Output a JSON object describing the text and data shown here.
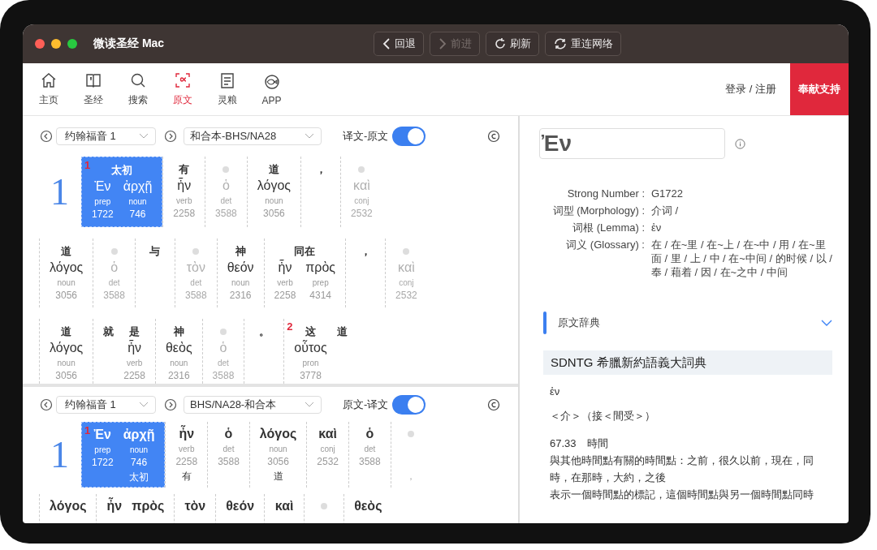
{
  "window": {
    "title": "微读圣经 Mac"
  },
  "toolbar": [
    {
      "kind": "back",
      "label": "回退",
      "disabled": false
    },
    {
      "kind": "forward",
      "label": "前进",
      "disabled": true
    },
    {
      "kind": "refresh",
      "label": "刷新",
      "disabled": false
    },
    {
      "kind": "sync",
      "label": "重连网络",
      "disabled": false
    }
  ],
  "nav": {
    "items": [
      {
        "kind": "home",
        "label": "主页",
        "selected": false
      },
      {
        "kind": "bible",
        "label": "圣经",
        "selected": false
      },
      {
        "kind": "search",
        "label": "搜索",
        "selected": false
      },
      {
        "kind": "original",
        "label": "原文",
        "selected": true
      },
      {
        "kind": "notes",
        "label": "灵粮",
        "selected": false
      },
      {
        "kind": "app",
        "label": "APP",
        "selected": false
      }
    ],
    "login": "登录 / 注册",
    "donate": "奉献支持"
  },
  "panes": [
    {
      "kind": "zh-first",
      "book": "约翰福音 1",
      "version": "和合本-BHS/NA28",
      "toggle": {
        "label": "译文-原文",
        "on": true
      },
      "lines": [
        {
          "verse": "1",
          "words": [
            {
              "selected": true,
              "faded": false,
              "mark": "1",
              "zh": "太初",
              "cols": [
                {
                  "greek": "Ἐν",
                  "pos": "prep",
                  "num": "1722"
                },
                {
                  "greek": "ἀρχῇ",
                  "pos": "noun",
                  "num": "746"
                }
              ]
            },
            {
              "selected": false,
              "faded": false,
              "cols": [
                {
                  "zh": "有",
                  "greek": "ἦν",
                  "pos": "verb",
                  "num": "2258"
                }
              ]
            },
            {
              "selected": false,
              "faded": true,
              "cols": [
                {
                  "greek": "ὁ",
                  "pos": "det",
                  "num": "3588"
                }
              ]
            },
            {
              "selected": false,
              "faded": false,
              "cols": [
                {
                  "zh": "道",
                  "greek": "λόγος",
                  "pos": "noun",
                  "num": "3056"
                }
              ]
            },
            {
              "selected": false,
              "faded": false,
              "cols": [
                {
                  "zh": "，"
                }
              ]
            },
            {
              "selected": false,
              "faded": true,
              "cols": [
                {
                  "greek": "καὶ",
                  "pos": "conj",
                  "num": "2532"
                }
              ]
            }
          ]
        },
        {
          "words": [
            {
              "selected": false,
              "faded": false,
              "cols": [
                {
                  "zh": "道",
                  "greek": "λόγος",
                  "pos": "noun",
                  "num": "3056"
                }
              ]
            },
            {
              "selected": false,
              "faded": true,
              "cols": [
                {
                  "greek": "ὁ",
                  "pos": "det",
                  "num": "3588"
                }
              ]
            },
            {
              "selected": false,
              "faded": false,
              "cols": [
                {
                  "zh": "与"
                }
              ]
            },
            {
              "selected": false,
              "faded": true,
              "cols": [
                {
                  "greek": "τὸν",
                  "pos": "det",
                  "num": "3588"
                }
              ]
            },
            {
              "selected": false,
              "faded": false,
              "cols": [
                {
                  "zh": "神",
                  "greek": "θεόν",
                  "pos": "noun",
                  "num": "2316"
                }
              ]
            },
            {
              "selected": false,
              "faded": false,
              "zh": "同在",
              "cols": [
                {
                  "greek": "ἦν",
                  "pos": "verb",
                  "num": "2258"
                },
                {
                  "greek": "πρὸς",
                  "pos": "prep",
                  "num": "4314"
                }
              ]
            },
            {
              "selected": false,
              "faded": false,
              "cols": [
                {
                  "zh": "，"
                }
              ]
            },
            {
              "selected": false,
              "faded": true,
              "cols": [
                {
                  "greek": "καὶ",
                  "pos": "conj",
                  "num": "2532"
                }
              ]
            }
          ]
        },
        {
          "words": [
            {
              "selected": false,
              "faded": false,
              "cols": [
                {
                  "zh": "道",
                  "greek": "λόγος",
                  "pos": "noun",
                  "num": "3056"
                }
              ]
            },
            {
              "selected": false,
              "faded": false,
              "cols": [
                {
                  "zh": "就"
                },
                {
                  "zh": "是",
                  "greek": "ἦν",
                  "pos": "verb",
                  "num": "2258"
                }
              ]
            },
            {
              "selected": false,
              "faded": false,
              "cols": [
                {
                  "zh": "神",
                  "greek": "θεὸς",
                  "pos": "noun",
                  "num": "2316"
                }
              ]
            },
            {
              "selected": false,
              "faded": true,
              "cols": [
                {
                  "greek": "ὁ",
                  "pos": "det",
                  "num": "3588"
                }
              ]
            },
            {
              "selected": false,
              "faded": false,
              "cols": [
                {
                  "zh": "。"
                }
              ]
            },
            {
              "selected": false,
              "faded": false,
              "mark": "2",
              "cols": [
                {
                  "zh": "这",
                  "greek": "οὗτος",
                  "pos": "pron",
                  "num": "3778"
                },
                {
                  "zh": "道"
                }
              ]
            }
          ]
        }
      ]
    },
    {
      "kind": "greek-first",
      "book": "约翰福音 1",
      "version": "BHS/NA28-和合本",
      "toggle": {
        "label": "原文-译文",
        "on": true
      },
      "lines": [
        {
          "verse": "1",
          "words": [
            {
              "selected": true,
              "faded": false,
              "mark": "1",
              "cols": [
                {
                  "greek": "Ἐν",
                  "pos": "prep",
                  "num": "1722"
                },
                {
                  "greek": "ἀρχῇ",
                  "pos": "noun",
                  "num": "746",
                  "zh": "太初"
                }
              ]
            },
            {
              "selected": false,
              "faded": false,
              "cols": [
                {
                  "greek": "ἦν",
                  "pos": "verb",
                  "num": "2258",
                  "zh": "有"
                }
              ]
            },
            {
              "selected": false,
              "faded": false,
              "cols": [
                {
                  "greek": "ὁ",
                  "pos": "det",
                  "num": "3588"
                }
              ]
            },
            {
              "selected": false,
              "faded": false,
              "cols": [
                {
                  "greek": "λόγος",
                  "pos": "noun",
                  "num": "3056",
                  "zh": "道"
                }
              ]
            },
            {
              "selected": false,
              "faded": false,
              "cols": [
                {
                  "greek": "καὶ",
                  "pos": "conj",
                  "num": "2532"
                }
              ]
            },
            {
              "selected": false,
              "faded": false,
              "cols": [
                {
                  "greek": "ὁ",
                  "pos": "det",
                  "num": "3588"
                }
              ]
            },
            {
              "selected": false,
              "faded": true,
              "cols": [
                {
                  "zh": "，"
                }
              ]
            }
          ]
        },
        {
          "words": [
            {
              "selected": false,
              "faded": false,
              "cols": [
                {
                  "greek": "λόγος"
                }
              ]
            },
            {
              "selected": false,
              "faded": false,
              "cols": [
                {
                  "greek": "ἦν"
                },
                {
                  "greek": "πρὸς"
                }
              ]
            },
            {
              "selected": false,
              "faded": false,
              "cols": [
                {
                  "greek": "τὸν"
                }
              ]
            },
            {
              "selected": false,
              "faded": false,
              "cols": [
                {
                  "greek": "θεόν"
                }
              ]
            },
            {
              "selected": false,
              "faded": false,
              "cols": [
                {
                  "greek": "καὶ"
                }
              ]
            },
            {
              "selected": false,
              "faded": true
            },
            {
              "selected": false,
              "faded": false,
              "cols": [
                {
                  "greek": "θεὸς"
                }
              ]
            }
          ]
        }
      ]
    }
  ],
  "word_panel": {
    "word": "Ἐν",
    "details": [
      {
        "label": "Strong Number :",
        "value": "G1722"
      },
      {
        "label": "词型 (Morphology) :",
        "value": "介词 /"
      },
      {
        "label": "词根 (Lemma) :",
        "value": "ἐν"
      },
      {
        "label": "词义 (Glossary) :",
        "value": "在 / 在~里 / 在~上 / 在~中 / 用 / 在~里面 / 里 / 上 / 中 / 在~中间 / 的时候 / 以 / 奉 / 藉着 / 因 / 在~之中 / 中间"
      }
    ],
    "section": {
      "title": "原文辞典"
    },
    "dictionary": {
      "title": "SDNTG 希臘新約語義大詞典",
      "paragraphs": [
        "ἐν",
        "＜介＞（接＜間受＞）"
      ],
      "lines": [
        "67.33　時間",
        "與其他時間點有關的時間點：之前，很久以前，現在，同時，在那時，大約，之後",
        "表示一個時間點的標記，這個時間點與另一個時間點同時"
      ]
    }
  }
}
